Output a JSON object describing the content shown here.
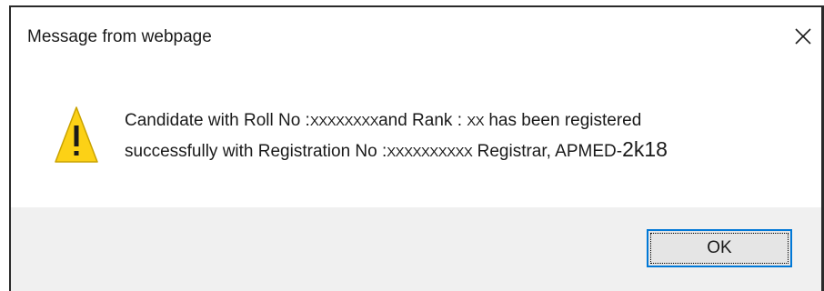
{
  "dialog": {
    "title": "Message from webpage",
    "close_icon": "close-icon",
    "warning_icon": "warning-triangle-icon",
    "message": {
      "line1_part1": "Candidate with Roll No :",
      "line1_roll": "XXXXXXXX",
      "line1_part2": "and Rank :",
      "line1_rank": "XX",
      "line1_part3": "has been registered",
      "line2_part1": "successfully with Registration No :",
      "line2_reg": "XXXXXXXXXX",
      "line2_part2": "Registrar, APMED-",
      "line2_year": "2k18"
    },
    "ok_label": "OK"
  },
  "colors": {
    "warning_yellow": "#fcd116",
    "button_border": "#0078d7",
    "button_bar": "#f0f0f0"
  }
}
